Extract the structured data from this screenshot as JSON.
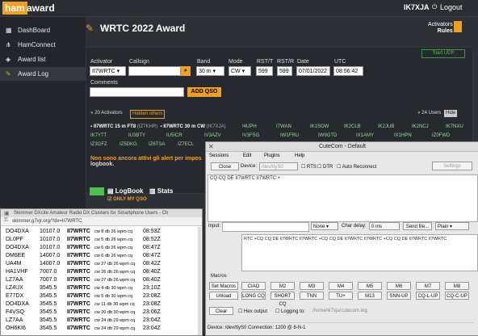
{
  "topbar": {
    "logo_ham": "ham",
    "logo_award": "award",
    "callsign": "IK7XJA",
    "logout": "Logout"
  },
  "sidebar": {
    "items": [
      {
        "label": "DashBoard",
        "icon": "dashboard-icon"
      },
      {
        "label": "HamConnect",
        "icon": "network-icon"
      },
      {
        "label": "Award list",
        "icon": "shield-icon"
      },
      {
        "label": "Award Log",
        "icon": "pencil-icon"
      }
    ]
  },
  "page": {
    "title": "WRTC 2022 Award",
    "rules_line1": "Activators",
    "rules_line2": "Rules"
  },
  "form": {
    "start_udp": "Start UDP",
    "activator_label": "Activator",
    "activator_value": "II7WRTC",
    "callsign_label": "Callsign",
    "callsign_value": "",
    "band_label": "Band",
    "band_value": "30 m",
    "mode_label": "Mode",
    "mode_value": "CW",
    "rstt_label": "RST/T",
    "rstt_value": "599",
    "rstr_label": "RST/R",
    "rstr_value": "599",
    "date_label": "Date",
    "date_value": "07/01/2022",
    "utc_label": "UTC",
    "utc_value": "08:56:42",
    "comments_label": "Comments",
    "comments_value": "",
    "add_qso": "ADD QSO"
  },
  "activators": {
    "count_label": "20 Activators",
    "hidden_label": "Hidden others",
    "users_label": "24 Users",
    "hide_label": "Hide"
  },
  "activity": {
    "line1_a": "II7WRTC 15 m FT8",
    "line1_a_sub": "(IZ7KHR)",
    "line1_b": "II7WRTC 30 m CW",
    "line1_b_sub": "(IK7XJA)",
    "calls_row1": [
      "I4UPH",
      "I7WAN",
      "IK1SOW",
      "IK2CLB",
      "IK2JUB",
      "IK2NCJ",
      "IK7NXU"
    ],
    "calls_row2": [
      "IK7YTT",
      "IU3BTY",
      "IU5ICR",
      "IV3AZV",
      "IV3FSG",
      "IW1FRU",
      "IW9GTD",
      "IX1AMY",
      "IX1HPN",
      "IZ0FWD"
    ],
    "calls_row3": [
      "IZ3GFZ",
      "IZ5DKG",
      "IZ6TSA",
      "IZ7ECL"
    ],
    "notice": "Non sono ancora attivi gli alert per impos",
    "notice2": "logbook."
  },
  "logbook": {
    "label": "LogBook",
    "stats": "Stats",
    "only_my": "ONLY MY QSO"
  },
  "cutecom": {
    "title": "CuteCom - Default",
    "menu": [
      "Sessions",
      "Edit",
      "Plugins",
      "Help"
    ],
    "close": "Close",
    "device_label": "Device:",
    "device_value": "/dev/ttyS0",
    "rts": "RTS",
    "dtr": "DTR",
    "auto_reconnect": "Auto Reconnect",
    "settings": "Settings",
    "output_text": "CQ CQ DE II7WRTC II7WRTC +",
    "input_label": "Input:",
    "none_sel": "None",
    "char_delay_label": "Char delay:",
    "char_delay_value": "0 ms",
    "send_file": "Send file...",
    "plain": "Plain",
    "sent_text": "RTC +CQ CQ DE II7WRTC II7WRTC +CQ CQ DE II7WRTC II7WRTC +CQ CQ DE II7WRTC II7WRTC",
    "macros_label": "Macros",
    "macros_row1": [
      "Set Macros",
      "CIAO",
      "M2",
      "M3",
      "M4",
      "M5",
      "M6",
      "M7",
      "M8"
    ],
    "macros_row2": [
      "Unload",
      "LONG CQ",
      "SHORT CQ",
      "TNN",
      "TU+",
      "M13",
      "SNN-UP",
      "CQ-L-UP",
      "CQ-C-UP"
    ],
    "clear": "Clear",
    "hex_output": "Hex output",
    "logging_to": "Logging to:",
    "log_path": "/home/ik7xja/cutecom.log",
    "status": "Device:  /dev/ttyS0      Connection: 1200 @ 8-N-1"
  },
  "skimmer": {
    "title": "Skimmer DXcite Amateur Radio DX Clusters for Smartphone Users - Ch",
    "url": "skimmer.g7vjr.org/?dx=II7WRTC",
    "rows": [
      {
        "spotter": "DO4DXA",
        "freq": "10107.0",
        "call": "II7WRTC",
        "info": "cw 8 db 26 wpm cq",
        "time": "08:53Z"
      },
      {
        "spotter": "DL0PF",
        "freq": "10107.0",
        "call": "II7WRTC",
        "info": "cw 5 db 26 wpm cq",
        "time": "08:52Z"
      },
      {
        "spotter": "DO4DXA",
        "freq": "10107.0",
        "call": "II7WRTC",
        "info": "cw 6 db 26 wpm cq",
        "time": "08:47Z"
      },
      {
        "spotter": "DM6EE",
        "freq": "14007.0",
        "call": "II7WRTC",
        "info": "cw 6 db 26 wpm cq",
        "time": "08:47Z"
      },
      {
        "spotter": "UA4M",
        "freq": "14007.0",
        "call": "II7WRTC",
        "info": "cw 27 db 26 wpm cq",
        "time": "08:42Z"
      },
      {
        "spotter": "HA1VHF",
        "freq": "7007.0",
        "call": "II7WRTC",
        "info": "cw 26 db 26 wpm cq",
        "time": "08:40Z"
      },
      {
        "spotter": "LZ7AA",
        "freq": "7007.0",
        "call": "II7WRTC",
        "info": "cw 27 db 26 wpm cq",
        "time": "08:40Z"
      },
      {
        "spotter": "LZ4UX",
        "freq": "3545.5",
        "call": "II7WRTC",
        "info": "cw 4 db 30 wpm cq",
        "time": "23:10Z"
      },
      {
        "spotter": "E77DX",
        "freq": "3545.5",
        "call": "II7WRTC",
        "info": "cw 5 db 30 wpm cq",
        "time": "23:08Z"
      },
      {
        "spotter": "DO4DXA",
        "freq": "3545.5",
        "call": "II7WRTC",
        "info": "cw 11 db 30 wpm cq",
        "time": "23:08Z"
      },
      {
        "spotter": "F4VSQ",
        "freq": "3545.5",
        "call": "II7WRTC",
        "info": "cw 20 db 30 wpm cq",
        "time": "23:06Z"
      },
      {
        "spotter": "LZ7AA",
        "freq": "3545.5",
        "call": "II7WRTC",
        "info": "cw 24 db 29 wpm cq",
        "time": "23:04Z"
      },
      {
        "spotter": "OH6KI6",
        "freq": "3545.5",
        "call": "II7WRTC",
        "info": "cw 24 db 29 wpm cq",
        "time": "23:04Z"
      }
    ]
  }
}
